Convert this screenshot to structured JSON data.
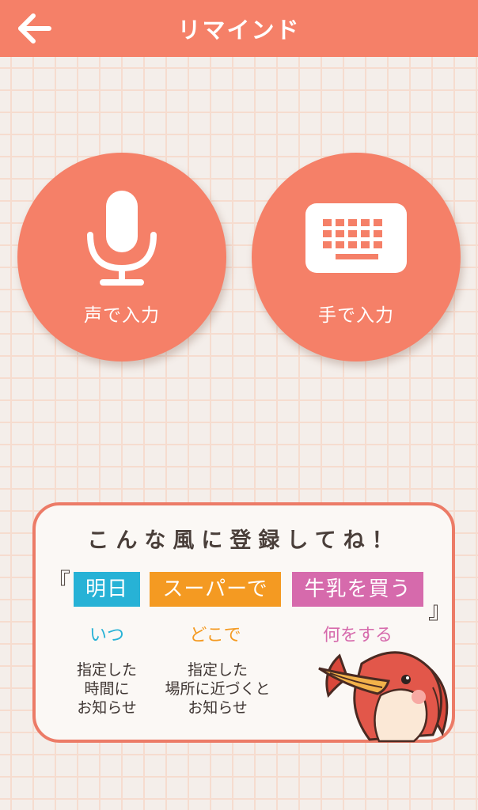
{
  "header": {
    "title": "リマインド",
    "back_icon": "arrow-left-icon"
  },
  "input_options": [
    {
      "label": "声で入力",
      "icon": "microphone-icon"
    },
    {
      "label": "手で入力",
      "icon": "keyboard-icon"
    }
  ],
  "info": {
    "title": "こんな風に登録してね！",
    "open_bracket": "『",
    "close_bracket": "』",
    "tags": [
      {
        "text": "明日",
        "caption": "いつ",
        "color": "#27b2d6"
      },
      {
        "text": "スーパーで",
        "caption": "どこで",
        "color": "#f49a22"
      },
      {
        "text": "牛乳を買う",
        "caption": "何をする",
        "color": "#d66aac"
      }
    ],
    "notes": [
      "指定した\n時間に\nお知らせ",
      "指定した\n場所に近づくと\nお知らせ"
    ]
  },
  "colors": {
    "accent": "#f58068",
    "background": "#f4eeea"
  }
}
